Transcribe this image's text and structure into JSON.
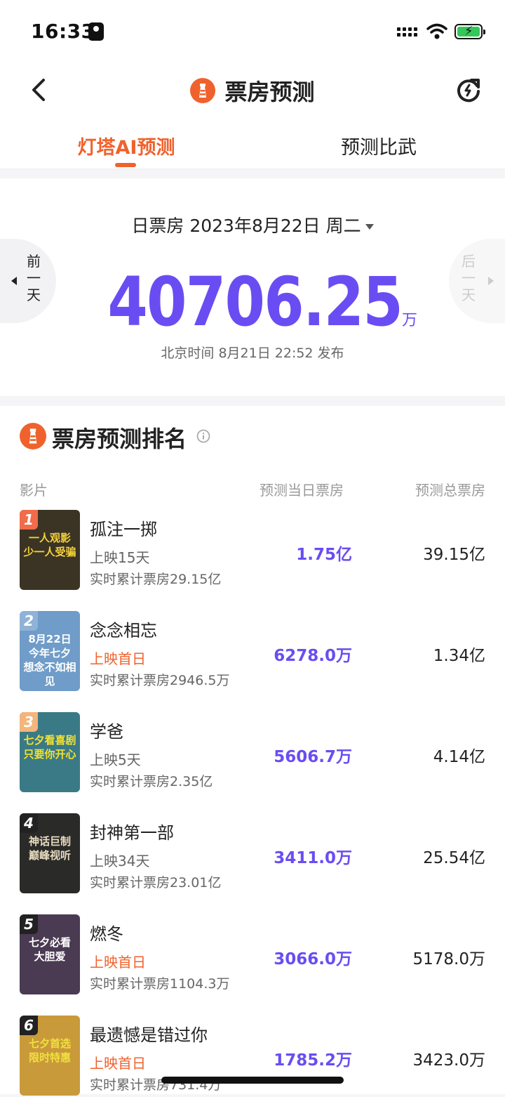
{
  "status_bar": {
    "time": "16:33"
  },
  "nav": {
    "title": "票房预测"
  },
  "tabs": [
    {
      "label": "灯塔AI预测"
    },
    {
      "label": "预测比武"
    }
  ],
  "summary": {
    "date_label": "日票房 2023年8月22日 周二",
    "prev_day": [
      "前",
      "一",
      "天"
    ],
    "next_day": [
      "后",
      "一",
      "天"
    ],
    "total_value": "40706.25",
    "total_unit": "万",
    "publish_time": "北京时间 8月21日 22:52 发布"
  },
  "ranking": {
    "title": "票房预测排名",
    "columns": {
      "film": "影片",
      "day": "预测当日票房",
      "total": "预测总票房"
    },
    "movies": [
      {
        "rank": "1",
        "name": "孤注一掷",
        "status": "上映15天",
        "first_day": false,
        "cumulative": "实时累计票房29.15亿",
        "day_forecast": "1.75亿",
        "total_forecast": "39.15亿",
        "poster_text": "一人观影 少一人受骗",
        "poster_color": "#3b3424",
        "poster_text_color": "#f4d23a",
        "badge_color": "#f26b4a"
      },
      {
        "rank": "2",
        "name": "念念相忘",
        "status": "上映首日",
        "first_day": true,
        "cumulative": "实时累计票房2946.5万",
        "day_forecast": "6278.0万",
        "total_forecast": "1.34亿",
        "poster_text": "8月22日 今年七夕 想念不如相见",
        "poster_color": "#6f9cc8",
        "poster_text_color": "#ffffff",
        "badge_color": "#8fb2d6"
      },
      {
        "rank": "3",
        "name": "学爸",
        "status": "上映5天",
        "first_day": false,
        "cumulative": "实时累计票房2.35亿",
        "day_forecast": "5606.7万",
        "total_forecast": "4.14亿",
        "poster_text": "七夕看喜剧 只要你开心",
        "poster_color": "#3a7a86",
        "poster_text_color": "#f3e230",
        "badge_color": "#f4b57a"
      },
      {
        "rank": "4",
        "name": "封神第一部",
        "status": "上映34天",
        "first_day": false,
        "cumulative": "实时累计票房23.01亿",
        "day_forecast": "3411.0万",
        "total_forecast": "25.54亿",
        "poster_text": "神话巨制 巅峰视听",
        "poster_color": "#2a2a28",
        "poster_text_color": "#e8dcc0",
        "badge_color": "#222222"
      },
      {
        "rank": "5",
        "name": "燃冬",
        "status": "上映首日",
        "first_day": true,
        "cumulative": "实时累计票房1104.3万",
        "day_forecast": "3066.0万",
        "total_forecast": "5178.0万",
        "poster_text": "七夕必看 大胆爱",
        "poster_color": "#4a3a52",
        "poster_text_color": "#ffffff",
        "badge_color": "#222222"
      },
      {
        "rank": "6",
        "name": "最遗憾是错过你",
        "status": "上映首日",
        "first_day": true,
        "cumulative": "实时累计票房731.4万",
        "day_forecast": "1785.2万",
        "total_forecast": "3423.0万",
        "poster_text": "七夕首选 限时特惠",
        "poster_color": "#c99a3a",
        "poster_text_color": "#f0e040",
        "badge_color": "#222222"
      }
    ]
  },
  "colors": {
    "accent": "#f0622d",
    "value": "#6a4df2"
  }
}
